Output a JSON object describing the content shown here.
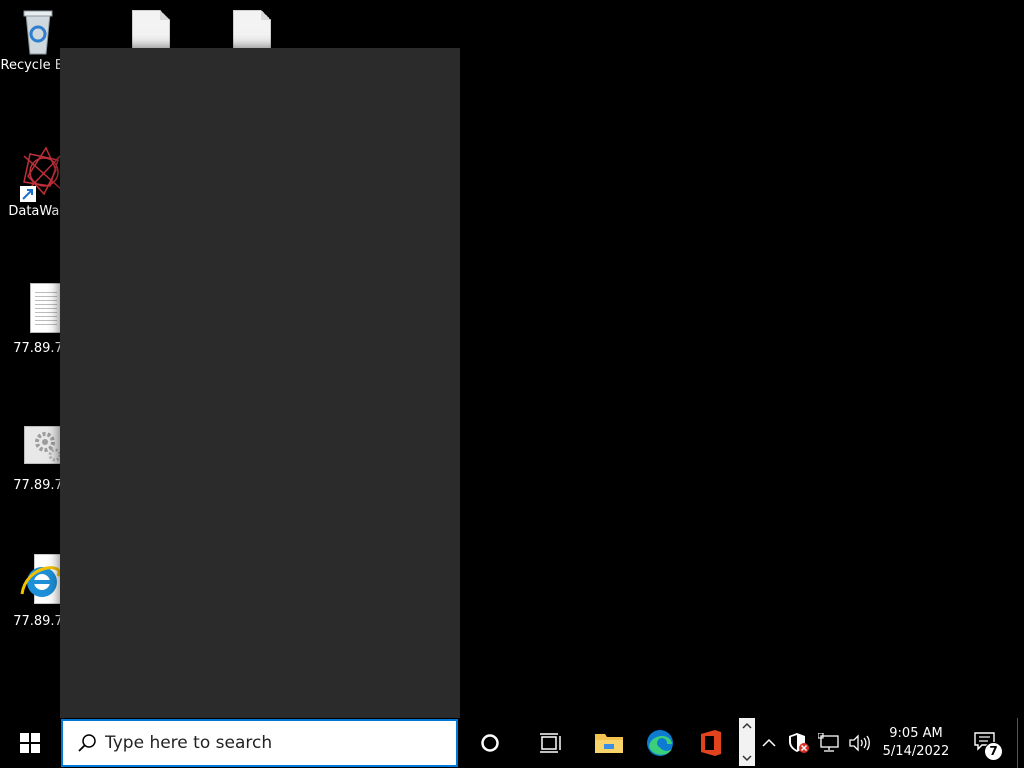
{
  "desktop": {
    "icons": [
      {
        "label": "Recycle Bin",
        "icon": "recycle-bin-icon"
      },
      {
        "label": "",
        "icon": "document-icon"
      },
      {
        "label": "",
        "icon": "document-icon"
      },
      {
        "label": "DataWag",
        "icon": "datawag-icon"
      },
      {
        "label": "77.89.7",
        "icon": "text-file-icon"
      },
      {
        "label": "77.89.7",
        "icon": "settings-file-icon"
      },
      {
        "label": "77.89.7",
        "icon": "internet-explorer-icon"
      }
    ]
  },
  "taskbar": {
    "start_icon": "windows-start-icon",
    "search": {
      "placeholder": "Type here to search",
      "value": "",
      "icon": "search-icon"
    },
    "cortana_icon": "cortana-icon",
    "task_view_icon": "task-view-icon",
    "pinned": [
      {
        "name": "File Explorer",
        "icon": "file-explorer-icon"
      },
      {
        "name": "Microsoft Edge",
        "icon": "edge-icon"
      },
      {
        "name": "Office",
        "icon": "office-icon"
      }
    ],
    "tray": {
      "time": "9:05 AM",
      "date": "5/14/2022",
      "notifications_count": "7",
      "icons": [
        "show-hidden-icons-chevron",
        "security-shield-icon",
        "network-icon",
        "volume-icon"
      ]
    }
  },
  "colors": {
    "desktop_background": "#000000",
    "panel_background": "#2b2b2b",
    "accent": "#0078d7"
  }
}
